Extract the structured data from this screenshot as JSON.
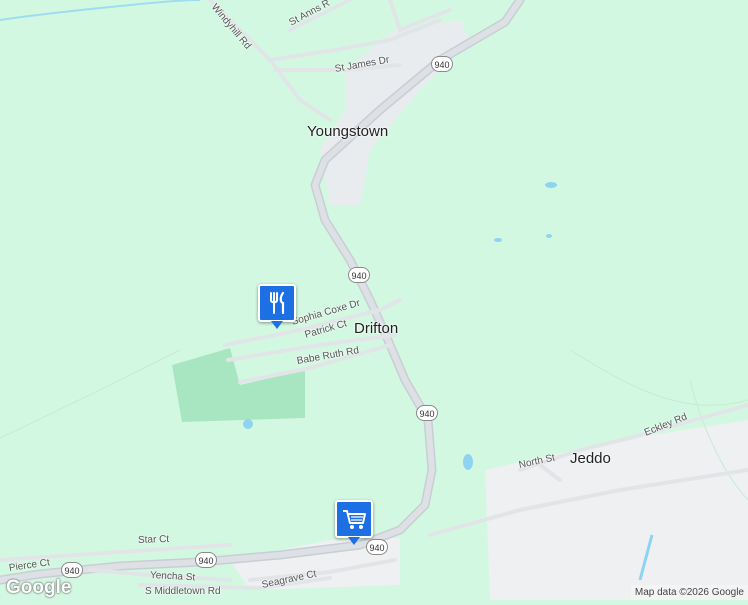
{
  "map": {
    "places": {
      "youngstown": "Youngstown",
      "drifton": "Drifton",
      "jeddo": "Jeddo"
    },
    "streets": {
      "windyhill": "Windyhill Rd",
      "st_anns": "St Anns R",
      "st_james": "St James Dr",
      "sophia_coxe": "Sophia Coxe Dr",
      "patrick": "Patrick Ct",
      "babe_ruth": "Babe Ruth Rd",
      "north": "North St",
      "eckley": "Eckley Rd",
      "star": "Star Ct",
      "pierce": "Pierce Ct",
      "yencha": "Yencha St",
      "s_middletown": "S Middletown Rd",
      "seagrave": "Seagrave Ct"
    },
    "route_number": "940",
    "pins": [
      {
        "type": "restaurant",
        "icon": "fork-knife-icon"
      },
      {
        "type": "shopping",
        "icon": "shopping-cart-icon"
      }
    ],
    "logo": "Google",
    "attribution": "Map data ©2026 Google",
    "colors": {
      "land": "#d3f8e2",
      "park": "#a8e6c2",
      "road": "#d9dde2",
      "water": "#8ed4f2",
      "pin": "#1d6fe4"
    }
  }
}
